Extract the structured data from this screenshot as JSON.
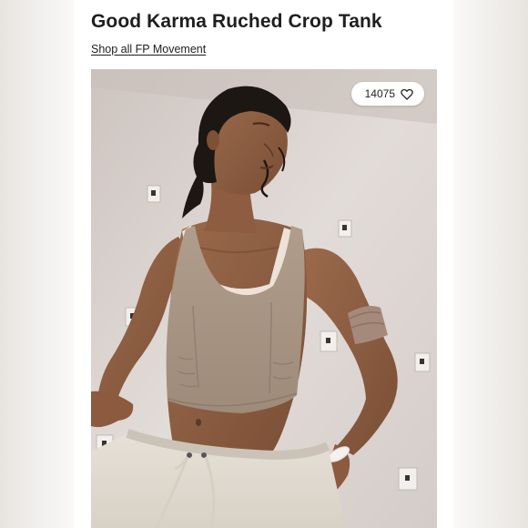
{
  "product": {
    "title": "Good Karma Ruched Crop Tank",
    "shop_link": "Shop all FP Movement"
  },
  "image": {
    "favorite_count": "14075",
    "favorite_icon": "heart-icon"
  },
  "colors": {
    "tank": "#a89584",
    "background_wall": "#ddd6d2"
  }
}
